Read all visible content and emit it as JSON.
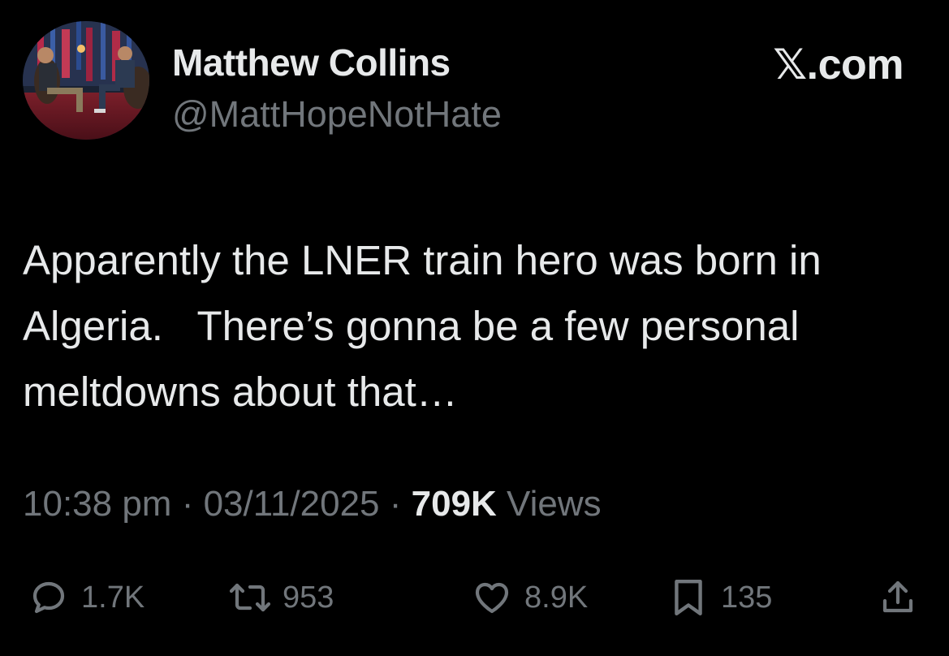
{
  "tweet": {
    "author": {
      "display_name": "Matthew Collins",
      "handle": "@MattHopeNotHate"
    },
    "brand": "𝕏.com",
    "text": "Apparently the LNER train hero was born in Algeria.   There’s gonna be a few personal meltdowns about that…",
    "meta": {
      "time": "10:38 pm",
      "separator": " · ",
      "date": "03/11/2025",
      "views_count": "709K",
      "views_label": " Views"
    },
    "actions": {
      "reply": {
        "icon": "reply-icon",
        "count": "1.7K"
      },
      "repost": {
        "icon": "repost-icon",
        "count": "953"
      },
      "like": {
        "icon": "heart-icon",
        "count": "8.9K"
      },
      "bookmark": {
        "icon": "bookmark-icon",
        "count": "135"
      },
      "share": {
        "icon": "share-icon"
      }
    }
  },
  "colors": {
    "background": "#000000",
    "primary_text": "#e7e9ea",
    "secondary_text": "#71767b"
  }
}
